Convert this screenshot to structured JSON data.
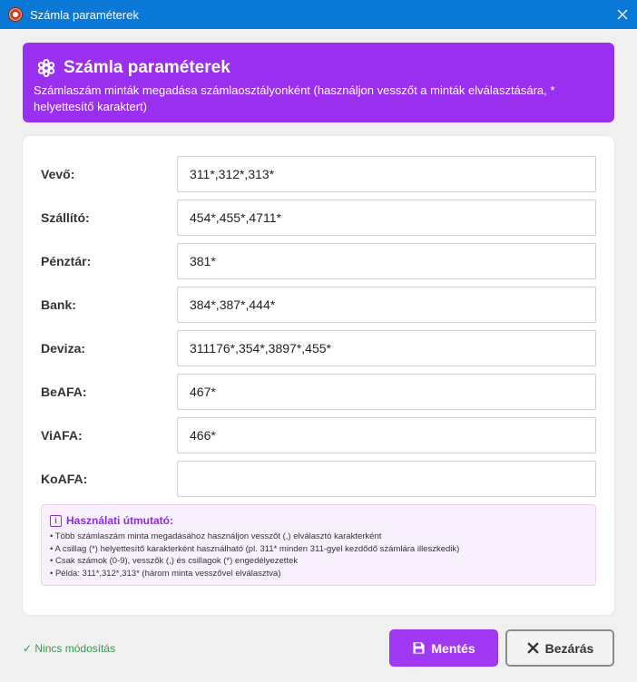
{
  "window": {
    "title": "Számla paraméterek",
    "titlebar_color": "#0a78d7"
  },
  "header": {
    "title": "Számla paraméterek",
    "subtitle": "Számlaszám minták megadása számlaosztályonként (használjon vesszőt a minták elválasztására, * helyettesítő karaktert)",
    "icon": "gear-icon",
    "color": "#9b2ff0"
  },
  "fields": [
    {
      "label": "Vevő:",
      "value": "311*,312*,313*"
    },
    {
      "label": "Szállító:",
      "value": "454*,455*,4711*"
    },
    {
      "label": "Pénztár:",
      "value": "381*"
    },
    {
      "label": "Bank:",
      "value": "384*,387*,444*"
    },
    {
      "label": "Deviza:",
      "value": "311176*,354*,3897*,455*"
    },
    {
      "label": "BeAFA:",
      "value": "467*"
    },
    {
      "label": "ViAFA:",
      "value": "466*"
    },
    {
      "label": "KoAFA:",
      "value": ""
    }
  ],
  "help": {
    "title": "Használati útmutató:",
    "icon": "info-icon",
    "items": [
      "Több számlaszám minta megadásához használjon vesszőt (,) elválasztó karakterként",
      "A csillag (*) helyettesítő karakterként használható (pl. 311* minden 311-gyel kezdődő számlára illeszkedik)",
      "Csak számok (0-9), vesszők (,) és csillagok (*) engedélyezettek",
      "Példa: 311*,312*,313* (három minta vesszővel elválasztva)"
    ]
  },
  "footer": {
    "status": "✓ Nincs módosítás",
    "save_label": "Mentés",
    "close_label": "Bezárás",
    "save_icon": "floppy-disk-icon",
    "close_icon": "close-x-icon",
    "accent_color": "#a139f2",
    "status_color": "#2e9b4a"
  }
}
